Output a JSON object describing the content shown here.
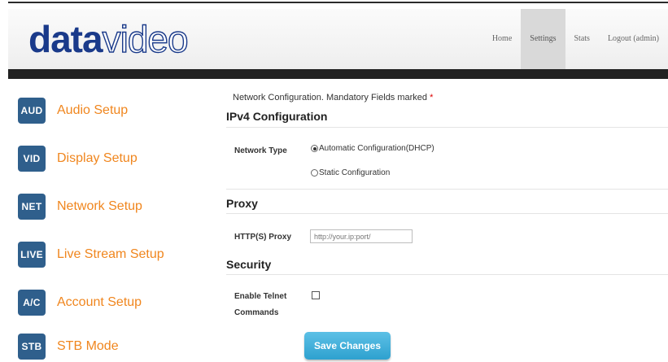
{
  "brand": {
    "logo_bold": "data",
    "logo_light": "video"
  },
  "nav": {
    "items": [
      "Home",
      "Settings",
      "Stats",
      "Logout (admin)"
    ],
    "active": "Settings"
  },
  "sidebar": {
    "items": [
      {
        "badge": "AUD",
        "label": "Audio Setup"
      },
      {
        "badge": "VID",
        "label": "Display Setup"
      },
      {
        "badge": "NET",
        "label": "Network Setup"
      },
      {
        "badge": "LIVE",
        "label": "Live Stream Setup"
      },
      {
        "badge": "A/C",
        "label": "Account Setup"
      },
      {
        "badge": "STB",
        "label": "STB Mode"
      }
    ]
  },
  "form": {
    "intro": "Network Configuration. Mandatory Fields marked",
    "required_mark": "*",
    "ipv4": {
      "title": "IPv4 Configuration",
      "network_type_label": "Network Type",
      "options": [
        "Automatic Configuration(DHCP)",
        "Static Configuration"
      ],
      "selected": "Automatic Configuration(DHCP)"
    },
    "proxy": {
      "title": "Proxy",
      "http_label": "HTTP(S) Proxy",
      "placeholder": "http://your.ip:port/",
      "value": ""
    },
    "security": {
      "title": "Security",
      "telnet_label_1": "Enable Telnet",
      "telnet_label_2": "Commands",
      "telnet_checked": false
    },
    "save_label": "Save Changes"
  },
  "colors": {
    "accent_orange": "#f0861e",
    "badge_blue": "#2f5f8c",
    "button_blue": "#3aaddb",
    "logo_blue": "#1a3a8a"
  }
}
